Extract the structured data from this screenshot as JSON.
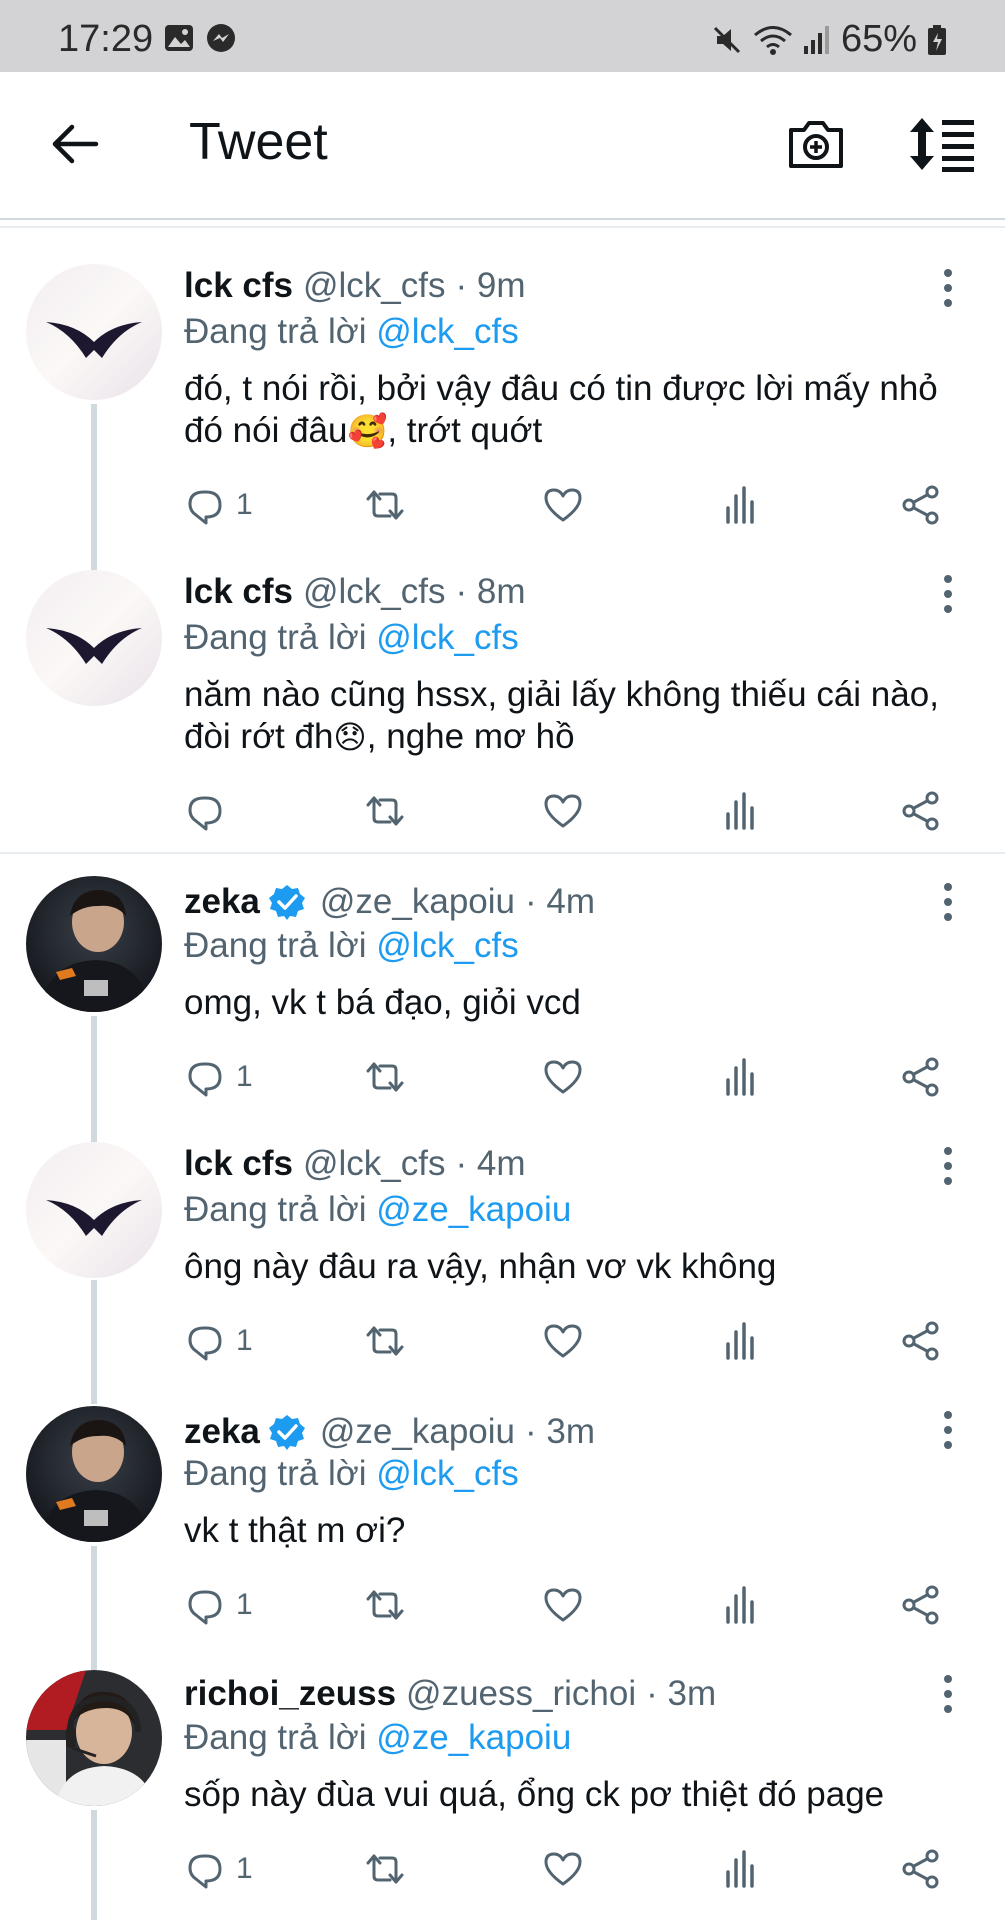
{
  "status_bar": {
    "time": "17:29",
    "battery": "65%"
  },
  "app_bar": {
    "title": "Tweet"
  },
  "reply_prefix": "Đang trả lời",
  "colors": {
    "accent": "#1d9bf0",
    "muted": "#536471",
    "text": "#0f1419"
  },
  "tweets": [
    {
      "name": "lck cfs",
      "handle": "@lck_cfs",
      "time": "· 9m",
      "reply_to": "@lck_cfs",
      "text_1": "đó, t nói rồi, bởi vậy đâu có tin được lời mấy nhỏ",
      "text_2a": "đó nói đâu",
      "emoji": "🥰",
      "text_2b": ", trớt quớt",
      "reply_count": "1",
      "avatar": "lck-logo"
    },
    {
      "name": "lck cfs",
      "handle": "@lck_cfs",
      "time": "· 8m",
      "reply_to": "@lck_cfs",
      "text_1": "năm nào cũng hssx, giải lấy không thiếu cái nào,",
      "text_2a": "đòi rớt đh",
      "emoji": "😞",
      "text_2b": ", nghe mơ hồ",
      "reply_count": "",
      "avatar": "lck-logo"
    },
    {
      "name": "zeka",
      "handle": "@ze_kapoiu",
      "time": "· 4m",
      "reply_to": "@lck_cfs",
      "text_1": "omg, vk t bá đạo, giỏi vcd",
      "reply_count": "1",
      "verified": true,
      "avatar": "player-photo"
    },
    {
      "name": "lck cfs",
      "handle": "@lck_cfs",
      "time": "· 4m",
      "reply_to": "@ze_kapoiu",
      "text_1": "ông này đâu ra vậy, nhận vơ vk không",
      "reply_count": "1",
      "avatar": "lck-logo"
    },
    {
      "name": "zeka",
      "handle": "@ze_kapoiu",
      "time": "· 3m",
      "reply_to": "@lck_cfs",
      "text_1": "vk t thật m ơi?",
      "reply_count": "1",
      "verified": true,
      "avatar": "player-photo"
    },
    {
      "name": "richoi_zeuss",
      "handle": "@zuess_richoi",
      "time": "· 3m",
      "reply_to": "@ze_kapoiu",
      "text_1": "sốp này đùa vui quá, ổng ck pơ thiệt đó page",
      "reply_count": "1",
      "avatar": "player-photo-2"
    }
  ]
}
